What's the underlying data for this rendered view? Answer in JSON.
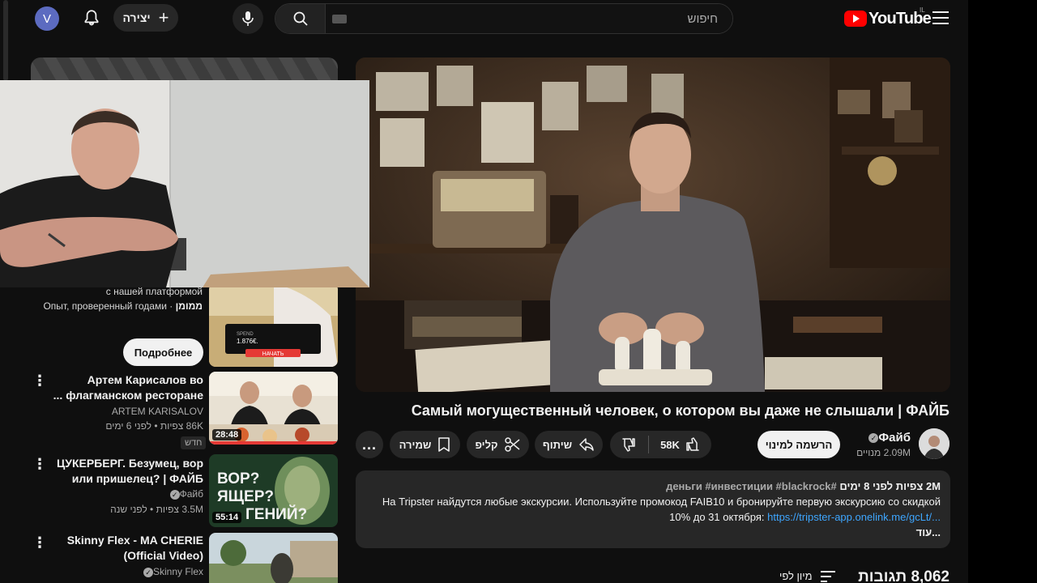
{
  "header": {
    "avatar_letter": "V",
    "create_label": "יצירה",
    "search_placeholder": "חיפוש",
    "logo_text": "YouTube",
    "region": "IL"
  },
  "video": {
    "title": "Самый могущественный человек, о котором вы даже не слышали | ФАЙБ",
    "channel": "Файб",
    "subscribers": "2.09M מנויים",
    "subscribe_label": "הרשמה למינוי",
    "likes": "58K",
    "share_label": "שיתוף",
    "clip_label": "קליפ",
    "save_label": "שמירה",
    "more_label": "..."
  },
  "description": {
    "views": "2M צפיות",
    "date": "לפני 8 ימים",
    "tags": "#деньги #инвестиции #blackrock",
    "text": "На Tripster найдутся любые экскурсии. Используйте промокод FAIB10 и бронируйте первую экскурсию со скидкой 10% до 31 октября: ",
    "link": "https://tripster-app.onelink.me/gcLt/...",
    "more": "...עוד"
  },
  "comments": {
    "count": "8,062 תגובות",
    "sort_label": "מיון לפי"
  },
  "ad": {
    "line1": "с нашей платформой",
    "line2": "Опыт, проверенный годами",
    "sponsored": "ממומן",
    "cta": "Подробнее",
    "thumb_spend_label": "SPEND",
    "thumb_spend_value": "1.876€.",
    "thumb_button": "НАЧАТЬ"
  },
  "recommendations": [
    {
      "title": "Артем Карисалов во флагманском ресторане ...",
      "channel": "ARTEM KARISALOV",
      "meta": "86K צפיות • לפני 6 ימים",
      "badge": "חדש",
      "duration": "28:48"
    },
    {
      "title": "ЦУКЕРБЕРГ. Безумец, вор или пришелец? | ФАЙБ",
      "channel": "Файб",
      "meta": "3.5M צפיות • לפני שנה",
      "duration": "55:14",
      "thumb_text": "ВОР? ЯЩЕР? ГЕНИЙ?",
      "thumb_line1": "ВОР?",
      "thumb_line2": "ЯЩЕР?",
      "thumb_line3": "ГЕНИЙ?"
    },
    {
      "title": "Skinny Flex - MA CHERIE (Official Video)",
      "channel": "Skinny Flex"
    }
  ],
  "colors": {
    "background": "#0f0f0f",
    "surface": "#272727",
    "brand_red": "#ff0000",
    "link": "#3ea6ff",
    "secondary_text": "#aaaaaa"
  }
}
